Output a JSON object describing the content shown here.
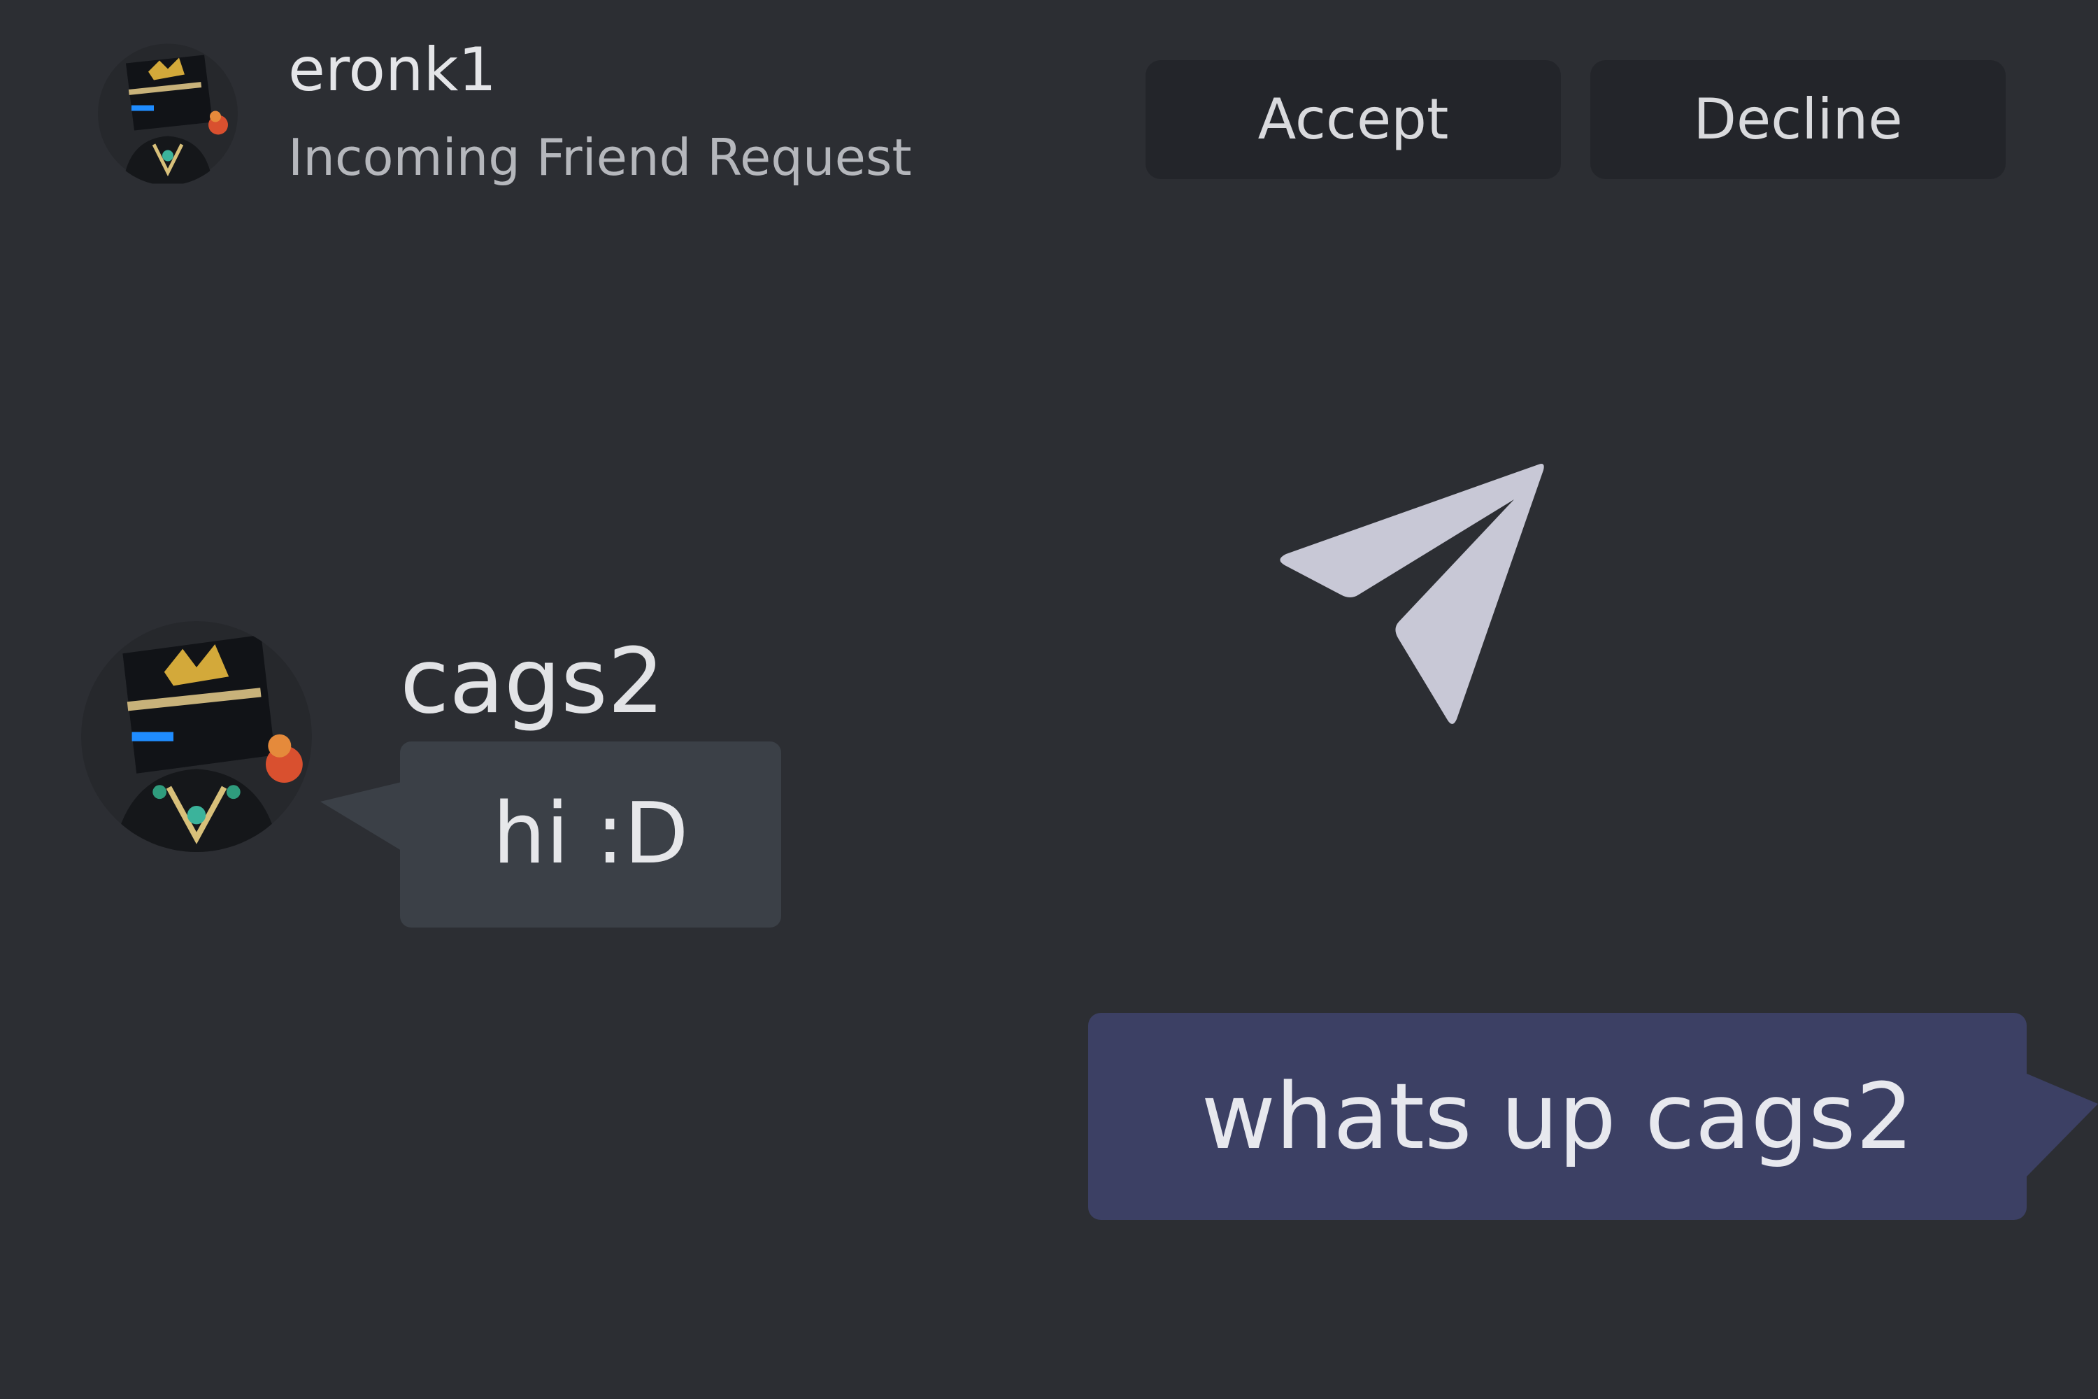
{
  "friend_request": {
    "username": "eronk1",
    "subtitle": "Incoming Friend Request",
    "accept_label": "Accept",
    "decline_label": "Decline",
    "avatar_icon": "avatar-icon"
  },
  "send_icon": "paper-plane-icon",
  "messages": [
    {
      "direction": "incoming",
      "sender": "cags2",
      "text": "hi :D",
      "bubble_color": "#3b4047"
    },
    {
      "direction": "outgoing",
      "text": "whats up cags2",
      "bubble_color": "#3c4064"
    }
  ],
  "colors": {
    "background": "#2c2e33",
    "button_bg": "#23252a",
    "icon": "#c8c8d6"
  }
}
